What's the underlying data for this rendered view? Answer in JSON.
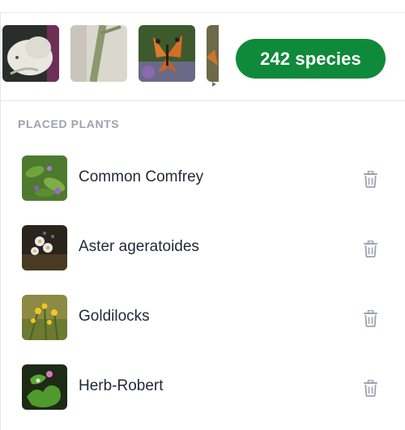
{
  "gallery": {
    "thumbnails": [
      {
        "icon": "white-butterfly-photo"
      },
      {
        "icon": "plant-stem-photo"
      },
      {
        "icon": "painted-lady-butterfly-photo"
      },
      {
        "icon": "partial-butterfly-photo"
      }
    ]
  },
  "species_badge": {
    "label": "242 species",
    "color": "#0f8a3a"
  },
  "placed_plants": {
    "title": "PLACED PLANTS",
    "items": [
      {
        "name": "Common Comfrey",
        "icon": "comfrey-photo"
      },
      {
        "name": "Aster ageratoides",
        "icon": "aster-photo"
      },
      {
        "name": "Goldilocks",
        "icon": "goldilocks-photo"
      },
      {
        "name": "Herb-Robert",
        "icon": "herb-robert-photo"
      }
    ],
    "delete_icon": "trash-icon"
  }
}
